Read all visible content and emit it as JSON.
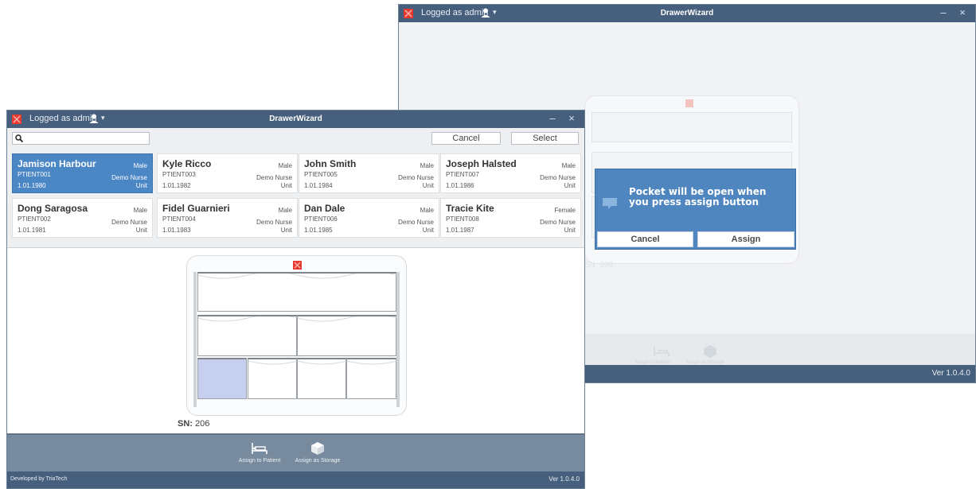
{
  "app": {
    "title": "DrawerWizard",
    "logged_as": "Logged as admin",
    "version": "Ver 1.0.4.0",
    "developer": "Developed by TriaTech",
    "accent_red": "#e8392f",
    "title_bar_color": "#465f7d"
  },
  "window_controls": {
    "minimize": "–",
    "close": "×"
  },
  "toolbar": {
    "search_placeholder": "",
    "cancel_label": "Cancel",
    "select_label": "Select"
  },
  "patients": [
    {
      "name": "Jamison Harbour",
      "id": "PTIENT001",
      "dob": "1.01.1980",
      "gender": "Male",
      "nurse": "Demo Nurse",
      "unit": "Unit",
      "selected": true
    },
    {
      "name": "Kyle Ricco",
      "id": "PTIENT003",
      "dob": "1.01.1982",
      "gender": "Male",
      "nurse": "Demo Nurse",
      "unit": "Unit"
    },
    {
      "name": "John Smith",
      "id": "PTIENT005",
      "dob": "1.01.1984",
      "gender": "Male",
      "nurse": "Demo Nurse",
      "unit": "Unit"
    },
    {
      "name": "Joseph Halsted",
      "id": "PTIENT007",
      "dob": "1.01.1986",
      "gender": "Male",
      "nurse": "Demo Nurse",
      "unit": "Unit"
    },
    {
      "name": "Dong Saragosa",
      "id": "PTIENT002",
      "dob": "1.01.1981",
      "gender": "Male",
      "nurse": "Demo Nurse",
      "unit": "Unit"
    },
    {
      "name": "Fidel Guarnieri",
      "id": "PTIENT004",
      "dob": "1.01.1983",
      "gender": "Male",
      "nurse": "Demo Nurse",
      "unit": "Unit"
    },
    {
      "name": "Dan Dale",
      "id": "PTIENT006",
      "dob": "1.01.1985",
      "gender": "Male",
      "nurse": "Demo Nurse",
      "unit": "Unit"
    },
    {
      "name": "Tracie Kite",
      "id": "PTIENT008",
      "dob": "1.01.1987",
      "gender": "Female",
      "nurse": "Demo Nurse",
      "unit": "Unit"
    }
  ],
  "drawer": {
    "sn_label": "SN:",
    "sn_value": "206",
    "active_pocket_color": "#c6cff0"
  },
  "actions": {
    "assign_patient": "Assign to Patient",
    "assign_storage": "Assign as Storage"
  },
  "dialog": {
    "message": "Pocket will be open when you press assign button",
    "cancel_label": "Cancel",
    "assign_label": "Assign",
    "color": "#4f86bf"
  },
  "back_window": {
    "sn_text": "SN: 206"
  },
  "icons": [
    "app-logo-icon",
    "user-icon",
    "search-icon",
    "bed-icon",
    "box-icon",
    "pocket-icon"
  ]
}
